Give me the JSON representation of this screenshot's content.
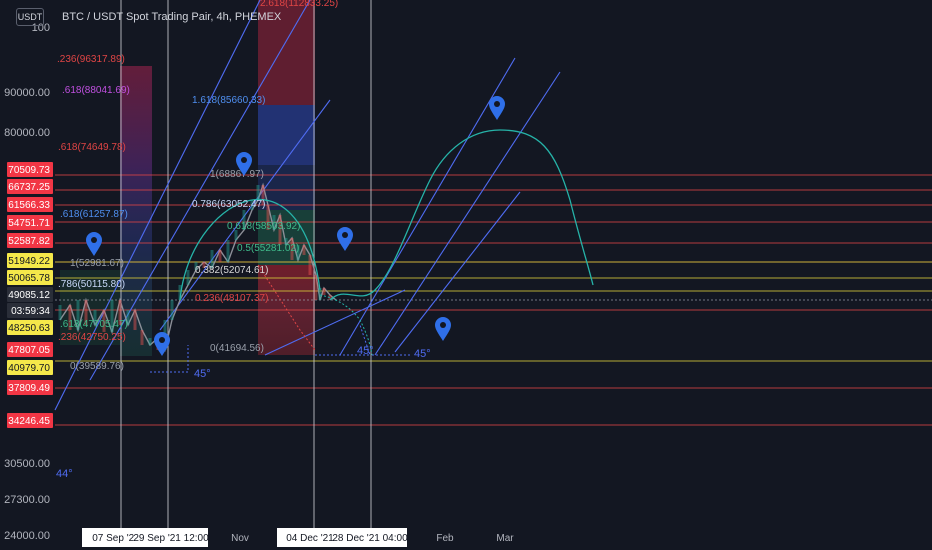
{
  "header": {
    "title": "BTC / USDT Spot Trading Pair, 4h, PHEMEX",
    "currency_button": "USDT"
  },
  "colors": {
    "background": "#131722",
    "axis_text": "#b2b5be",
    "level_line": "#e04545",
    "yellow_line": "#d4c63a",
    "white_line": "#c8cad0",
    "channel": "#4f6cf2",
    "arc": "#26b3a8",
    "price": "#8c8f98",
    "marker": "#2f6fe8"
  },
  "chart_data": {
    "type": "line",
    "title": "BTC / USDT Spot Trading Pair, 4h, PHEMEX",
    "y_axis_labels": [
      "100",
      "90000.00",
      "80000.00",
      "30500.00",
      "27300.00",
      "24000.00"
    ],
    "x_axis_labels": [
      "07 Sep '21",
      "29 Sep '21  12:00",
      "Nov",
      "04 Dec '21",
      "28 Dec '21  04:00",
      "Feb",
      "Mar"
    ],
    "x_label_boxed": [
      true,
      true,
      false,
      true,
      true,
      false,
      false
    ],
    "price_badges": [
      {
        "label": "70509.73",
        "style": "red"
      },
      {
        "label": "66737.25",
        "style": "red"
      },
      {
        "label": "61566.33",
        "style": "red"
      },
      {
        "label": "54751.71",
        "style": "red"
      },
      {
        "label": "52587.82",
        "style": "red"
      },
      {
        "label": "51949.22",
        "style": "yellow"
      },
      {
        "label": "50065.78",
        "style": "yellow"
      },
      {
        "label": "49085.12",
        "style": "dark"
      },
      {
        "label": "03:59:34",
        "style": "dark"
      },
      {
        "label": "48250.63",
        "style": "yellow"
      },
      {
        "label": "47807.05",
        "style": "red"
      },
      {
        "label": "40979.70",
        "style": "yellow"
      },
      {
        "label": "37809.49",
        "style": "red"
      },
      {
        "label": "34246.45",
        "style": "red"
      }
    ],
    "fib_labels": [
      {
        "text": "2.618(112833.25)",
        "color": "#e04545"
      },
      {
        "text": "1.618(85660.33)",
        "color": "#4f8ff0"
      },
      {
        "text": "1(68867.97)",
        "color": "#9aa0ab"
      },
      {
        "text": "0.786(63052.47)",
        "color": "#c8d8f8"
      },
      {
        "text": "0.618(58503.92)",
        "color": "#3fb98a"
      },
      {
        "text": "0.5(55281.02)",
        "color": "#3fb98a"
      },
      {
        "text": "0.382(52074.61)",
        "color": "#d8d8d8"
      },
      {
        "text": "0.236(48107.37)",
        "color": "#e04545"
      },
      {
        "text": "0(41694.56)",
        "color": "#9aa0ab"
      },
      {
        "text": ".236(96317.89)",
        "color": "#e04545"
      },
      {
        "text": ".618(88041.69)",
        "color": "#c050e0"
      },
      {
        "text": ".618(74649.78)",
        "color": "#e04545"
      },
      {
        "text": ".618(61257.87)",
        "color": "#4f8ff0"
      },
      {
        "text": "1(52981.67)",
        "color": "#9aa0ab"
      },
      {
        "text": ".786(50115.80)",
        "color": "#c8d8f8"
      },
      {
        "text": ".618(47705.47)",
        "color": "#3fb98a"
      },
      {
        "text": ".236(42750.25)",
        "color": "#e04545"
      },
      {
        "text": "0(39589.76)",
        "color": "#9aa0ab"
      }
    ],
    "angle_labels": [
      "45°",
      "45°",
      "45°",
      "44°"
    ],
    "grid": false,
    "legend": "none"
  }
}
